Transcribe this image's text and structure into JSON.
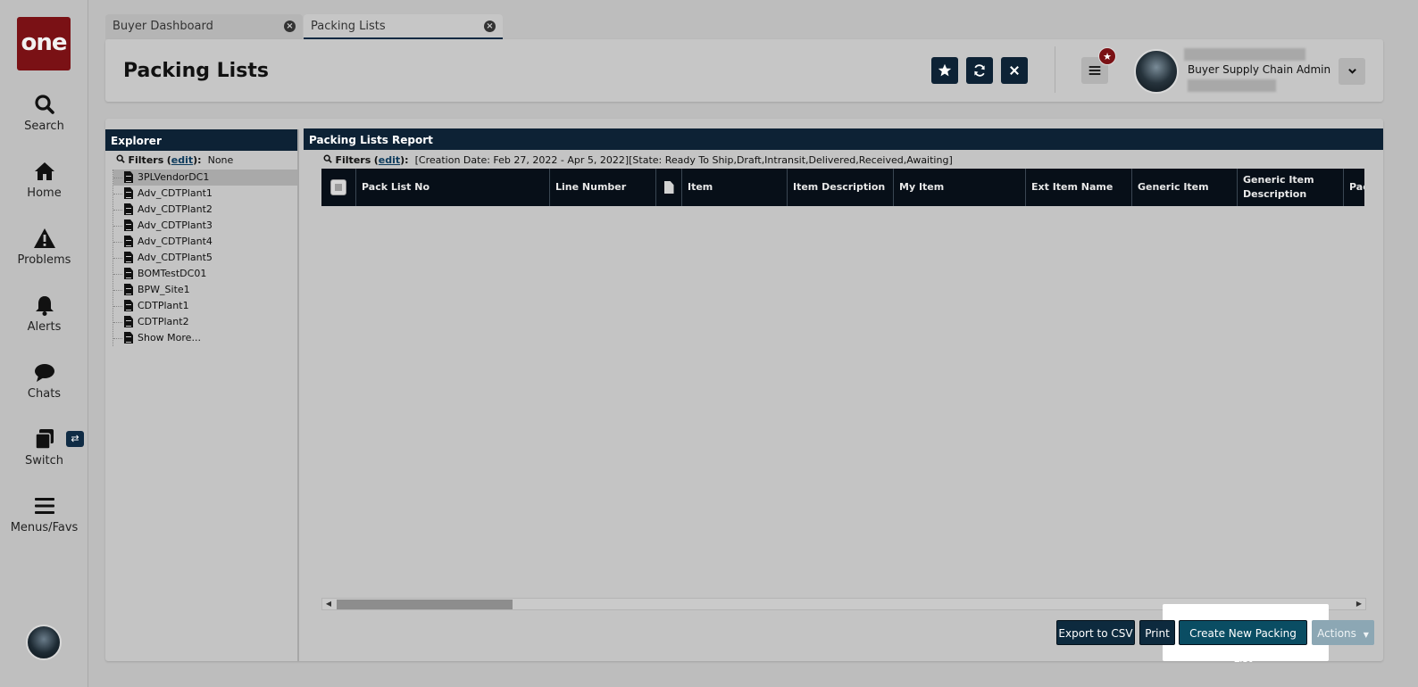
{
  "app": {
    "logo_text": "one"
  },
  "nav": [
    {
      "label": "Search",
      "icon": "search-icon"
    },
    {
      "label": "Home",
      "icon": "home-icon"
    },
    {
      "label": "Problems",
      "icon": "warning-icon"
    },
    {
      "label": "Alerts",
      "icon": "bell-icon"
    },
    {
      "label": "Chats",
      "icon": "chat-icon"
    },
    {
      "label": "Switch",
      "icon": "switch-icon"
    },
    {
      "label": "Menus/Favs",
      "icon": "menu-icon"
    }
  ],
  "tabs": [
    {
      "label": "Buyer Dashboard",
      "active": false
    },
    {
      "label": "Packing Lists",
      "active": true
    }
  ],
  "header": {
    "title": "Packing Lists",
    "user_role": "Buyer Supply Chain Admin"
  },
  "explorer": {
    "title": "Explorer",
    "filters_label": "Filters",
    "edit_label": "edit",
    "filters_value": "None",
    "items": [
      "3PLVendorDC1",
      "Adv_CDTPlant1",
      "Adv_CDTPlant2",
      "Adv_CDTPlant3",
      "Adv_CDTPlant4",
      "Adv_CDTPlant5",
      "BOMTestDC01",
      "BPW_Site1",
      "CDTPlant1",
      "CDTPlant2",
      "Show More..."
    ]
  },
  "report": {
    "title": "Packing Lists Report",
    "filters_label": "Filters",
    "edit_label": "edit",
    "filters_value": "[Creation Date: Feb 27, 2022 - Apr 5, 2022][State: Ready To Ship,Draft,Intransit,Delivered,Received,Awaiting]",
    "columns": [
      "Pack List No",
      "Line Number",
      "",
      "Item",
      "Item Description",
      "My Item",
      "Ext Item Name",
      "Generic Item",
      "Generic Item Description",
      "Pac"
    ]
  },
  "footer": {
    "export_label": "Export to CSV",
    "print_label": "Print",
    "create_label": "Create New Packing List",
    "actions_label": "Actions"
  },
  "colors": {
    "brand": "#7a1115",
    "navy": "#0d2235",
    "background": "#bdbdbd"
  }
}
